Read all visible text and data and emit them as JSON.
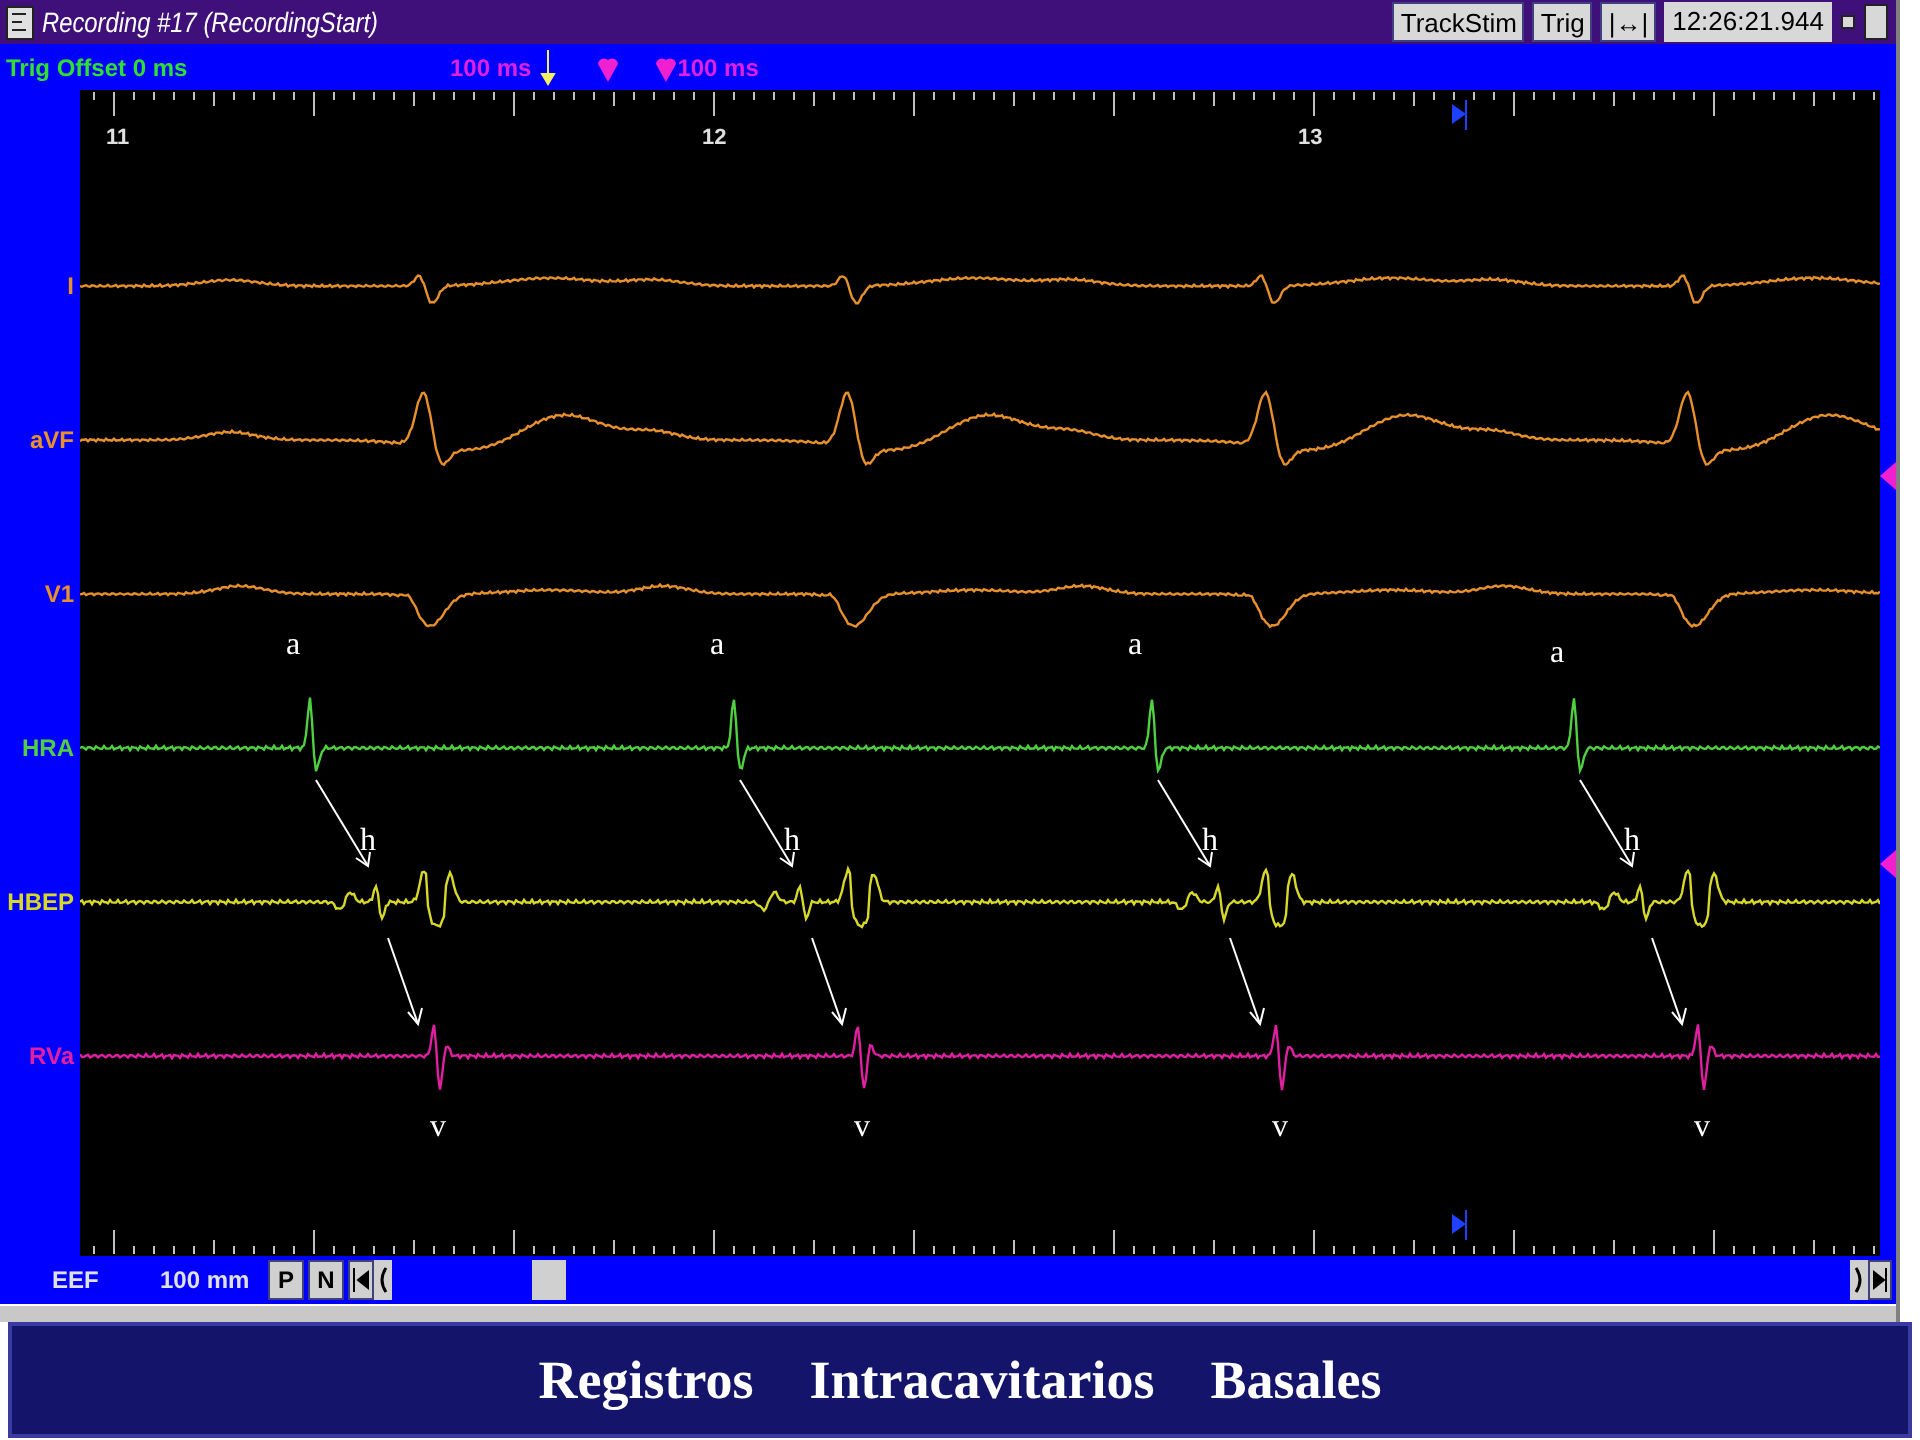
{
  "window": {
    "title": "Recording #17 (RecordingStart)",
    "buttons": [
      "TrackStim",
      "Trig",
      "|↔|"
    ],
    "clock": "12:26:21.944"
  },
  "info_bar": {
    "trig_offset": "Trig Offset 0 ms",
    "pre_interval": "100 ms",
    "post_interval": "100 ms"
  },
  "time_axis": [
    "11",
    "12",
    "13"
  ],
  "channels": [
    {
      "name": "I",
      "color": "#e8902a"
    },
    {
      "name": "aVF",
      "color": "#e8902a"
    },
    {
      "name": "V1",
      "color": "#e8902a"
    },
    {
      "name": "HRA",
      "color": "#50d040"
    },
    {
      "name": "HBEP",
      "color": "#d8d828"
    },
    {
      "name": "RVa",
      "color": "#e020a0"
    }
  ],
  "annotations": [
    {
      "atrial": "a",
      "his": "h",
      "ventricular": "v"
    },
    {
      "atrial": "a",
      "his": "h",
      "ventricular": "v"
    },
    {
      "atrial": "a",
      "his": "h",
      "ventricular": "v"
    },
    {
      "atrial": "a",
      "his": "h",
      "ventricular": "v"
    }
  ],
  "bottom_bar": {
    "channel": "EEF",
    "speed": "100 mm",
    "buttons": [
      "P",
      "N"
    ]
  },
  "caption": [
    "Registros",
    "Intracavitarios",
    "Basales"
  ]
}
